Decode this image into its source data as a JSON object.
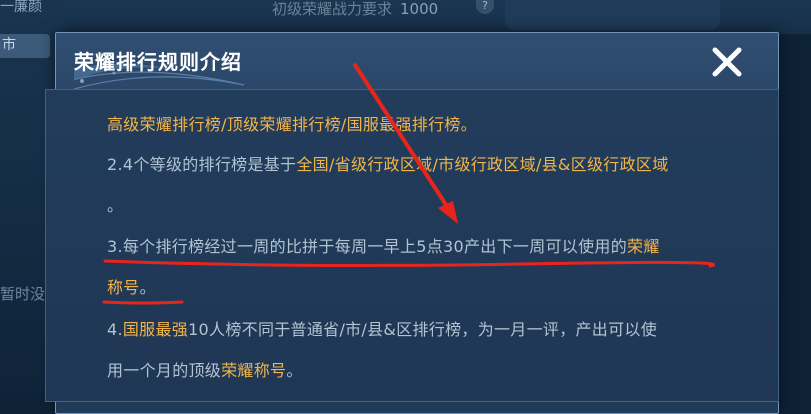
{
  "background": {
    "top_left_text": "一廉颜",
    "left_city_label": "市",
    "left_side_text": "暂时没",
    "top_requirement_label": "初级荣耀战力要求",
    "top_requirement_value": "1000",
    "help_icon_glyph": "?"
  },
  "dialog": {
    "title": "荣耀排行规则介绍",
    "close_glyph": "✕",
    "lines": [
      {
        "segments": [
          {
            "text": "高级荣耀排行榜/顶级荣耀排行榜/国服最强排行榜。",
            "highlight": true
          }
        ]
      },
      {
        "segments": [
          {
            "text": "2.4个等级的排行榜是基于",
            "highlight": false
          },
          {
            "text": "全国/省级行政区域/市级行政区域/县&区级行政区域",
            "highlight": true
          }
        ]
      },
      {
        "segments": [
          {
            "text": "。",
            "highlight": false
          }
        ]
      },
      {
        "segments": [
          {
            "text": "3.每个排行榜经过一周的比拼于每周一早上5点30产出下一周可以使用的",
            "highlight": false
          },
          {
            "text": "荣耀",
            "highlight": true
          }
        ]
      },
      {
        "segments": [
          {
            "text": "称号",
            "highlight": true
          },
          {
            "text": "。",
            "highlight": false
          }
        ]
      },
      {
        "segments": [
          {
            "text": "4.",
            "highlight": false
          },
          {
            "text": "国服最强",
            "highlight": true
          },
          {
            "text": "10人榜不同于普通省/市/县&区排行榜，为一月一评，产出可以使",
            "highlight": false
          }
        ]
      },
      {
        "segments": [
          {
            "text": "用一个月的顶级",
            "highlight": false
          },
          {
            "text": "荣耀称号",
            "highlight": true
          },
          {
            "text": "。",
            "highlight": false
          }
        ]
      }
    ]
  },
  "colors": {
    "highlight": "#f2b54a",
    "body_text": "#b2c3d3",
    "annotation": "#e8251c",
    "dialog_bg": "#243f5f"
  }
}
